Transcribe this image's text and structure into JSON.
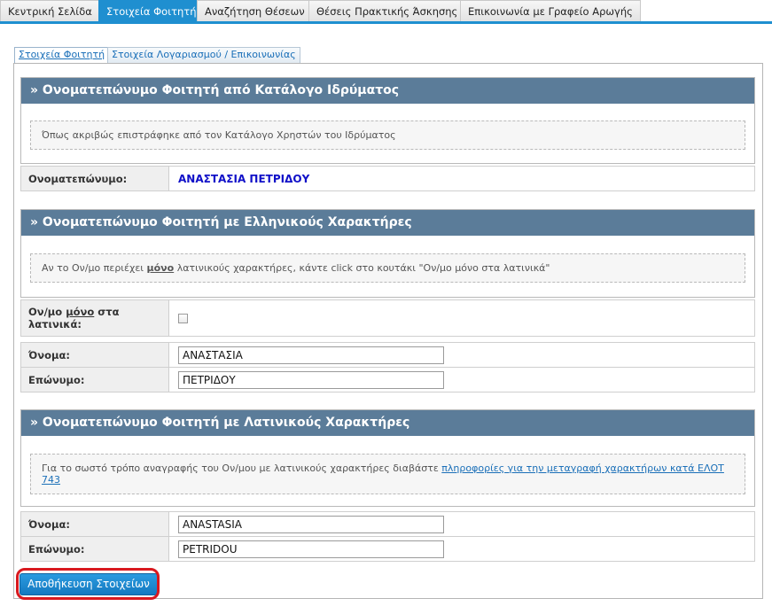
{
  "topnav": {
    "tabs": [
      {
        "label": "Κεντρική Σελίδα",
        "active": false
      },
      {
        "label": "Στοιχεία Φοιτητή",
        "active": true
      },
      {
        "label": "Αναζήτηση Θέσεων",
        "active": false
      },
      {
        "label": "Θέσεις Πρακτικής Άσκησης",
        "active": false
      },
      {
        "label": "Επικοινωνία με Γραφείο Αρωγής",
        "active": false
      }
    ]
  },
  "subtabs": [
    {
      "label": "Στοιχεία Φοιτητή",
      "active": true
    },
    {
      "label": "Στοιχεία Λογαριασμού / Επικοινωνίας",
      "active": false
    }
  ],
  "section1": {
    "title": "» Ονοματεπώνυμο Φοιτητή από Κατάλογο Ιδρύματος",
    "notice": "Όπως ακριβώς επιστράφηκε από τον Κατάλογο Χρηστών του Ιδρύματος",
    "fullname_label": "Ονοματεπώνυμο:",
    "fullname_value": "ΑΝΑΣΤΑΣΙΑ ΠΕΤΡΙΔΟΥ"
  },
  "section2": {
    "title": "» Ονοματεπώνυμο Φοιτητή με Ελληνικούς Χαρακτήρες",
    "notice_before": "Αν το Ον/μο περιέχει ",
    "notice_emphasis": "μόνο",
    "notice_after": " λατινικούς χαρακτήρες, κάντε click στο κουτάκι \"Ον/μο μόνο στα λατινικά\"",
    "latin_only_label_before": "Ον/μο ",
    "latin_only_label_emphasis": "μόνο",
    "latin_only_label_after": " στα λατινικά:",
    "latin_only_checked": false,
    "first_name_label": "Όνομα:",
    "first_name_value": "ΑΝΑΣΤΑΣΙΑ",
    "last_name_label": "Επώνυμο:",
    "last_name_value": "ΠΕΤΡΙΔΟΥ"
  },
  "section3": {
    "title": "» Ονοματεπώνυμο Φοιτητή με Λατινικούς Χαρακτήρες",
    "notice_text": "Για το σωστό τρόπο αναγραφής του Ον/μου με λατινικούς χαρακτήρες διαβάστε ",
    "notice_link": "πληροφορίες για την μεταγραφή χαρακτήρων κατά ΕΛΟΤ 743",
    "first_name_label": "Όνομα:",
    "first_name_value": "ANASTASIA",
    "last_name_label": "Επώνυμο:",
    "last_name_value": "PETRIDOU"
  },
  "save_button": "Αποθήκευση Στοιχείων",
  "colors": {
    "accent": "#1f8fd0",
    "panel_header": "#5b7c99",
    "highlight": "#d8191f",
    "fullname": "#1010c8"
  }
}
